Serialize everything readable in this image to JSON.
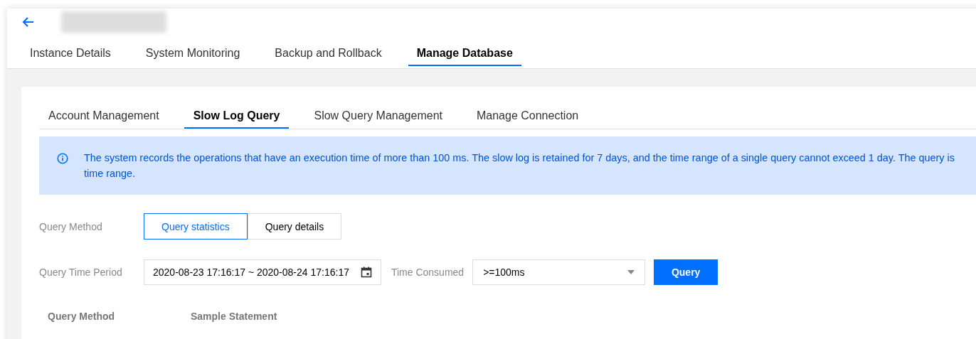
{
  "header": {
    "back": true,
    "redacted_title": true
  },
  "tabs": [
    {
      "label": "Instance Details",
      "selected": false
    },
    {
      "label": "System Monitoring",
      "selected": false
    },
    {
      "label": "Backup and Rollback",
      "selected": false
    },
    {
      "label": "Manage Database",
      "selected": true
    }
  ],
  "subtabs": [
    {
      "label": "Account Management",
      "selected": false
    },
    {
      "label": "Slow Log Query",
      "selected": true
    },
    {
      "label": "Slow Query Management",
      "selected": false
    },
    {
      "label": "Manage Connection",
      "selected": false
    }
  ],
  "notice": {
    "lines": [
      "The system records the operations that have an execution time of more than 100 ms. The slow log is retained for 7 days, and the time range of a single query cannot exceed 1 day. The query is",
      "time range."
    ]
  },
  "query_method": {
    "label": "Query Method",
    "options": [
      {
        "label": "Query statistics",
        "selected": true
      },
      {
        "label": "Query details",
        "selected": false
      }
    ]
  },
  "time_period": {
    "label": "Query Time Period",
    "value": "2020-08-23 17:16:17 ~ 2020-08-24 17:16:17"
  },
  "time_consumed": {
    "label": "Time Consumed",
    "value": ">=100ms"
  },
  "query_button": "Query",
  "table": {
    "columns": [
      "Query Method",
      "Sample Statement"
    ]
  }
}
